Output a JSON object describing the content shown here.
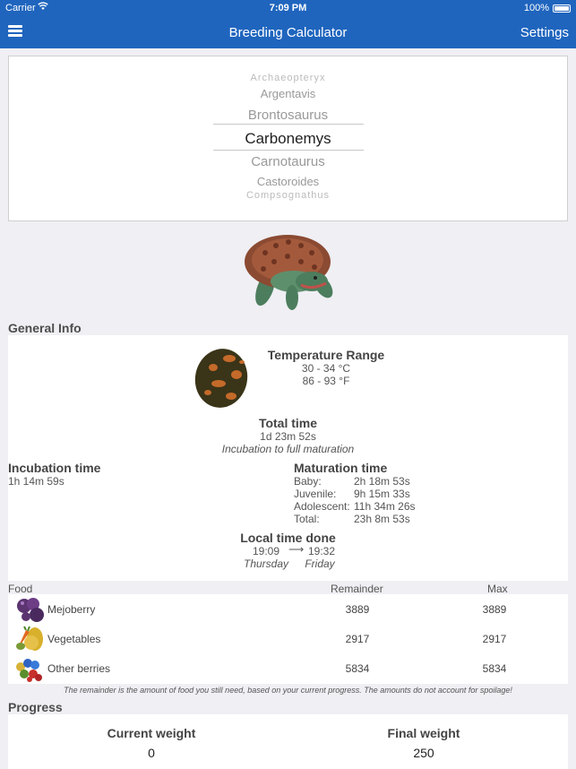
{
  "status_bar": {
    "carrier": "Carrier",
    "time": "7:09 PM",
    "battery": "100%"
  },
  "nav": {
    "title": "Breeding Calculator",
    "settings_label": "Settings"
  },
  "picker": {
    "items": [
      "Archaeopteryx",
      "Argentavis",
      "Brontosaurus",
      "Carbonemys",
      "Carnotaurus",
      "Castoroides",
      "Compsognathus"
    ],
    "selected": "Carbonemys"
  },
  "general_info": {
    "label": "General Info",
    "temperature": {
      "title": "Temperature Range",
      "celsius": "30 - 34 °C",
      "fahrenheit": "86 - 93 °F"
    },
    "total": {
      "title": "Total time",
      "value": "1d 23m 52s",
      "note": "Incubation to full maturation"
    },
    "incubation": {
      "title": "Incubation time",
      "value": "1h 14m 59s"
    },
    "maturation": {
      "title": "Maturation time",
      "rows": [
        {
          "label": "Baby:",
          "value": "2h 18m 53s"
        },
        {
          "label": "Juvenile:",
          "value": "9h 15m 33s"
        },
        {
          "label": "Adolescent:",
          "value": "11h 34m 26s"
        },
        {
          "label": "Total:",
          "value": "23h 8m 53s"
        }
      ]
    },
    "local_time": {
      "title": "Local time done",
      "start_time": "19:09",
      "end_time": "19:32",
      "start_day": "Thursday",
      "end_day": "Friday"
    }
  },
  "food": {
    "headers": {
      "food": "Food",
      "remainder": "Remainder",
      "max": "Max"
    },
    "rows": [
      {
        "name": "Mejoberry",
        "remainder": "3889",
        "max": "3889",
        "icon": "mejoberry-icon"
      },
      {
        "name": "Vegetables",
        "remainder": "2917",
        "max": "2917",
        "icon": "vegetables-icon"
      },
      {
        "name": "Other berries",
        "remainder": "5834",
        "max": "5834",
        "icon": "berries-icon"
      }
    ],
    "note": "The remainder is the amount of food you still need, based on your current progress. The amounts do not account for spoilage!"
  },
  "progress": {
    "label": "Progress",
    "current_label": "Current weight",
    "current_value": "0",
    "final_label": "Final weight",
    "final_value": "250"
  },
  "colors": {
    "nav": "#1f65be",
    "background": "#efeff4"
  }
}
